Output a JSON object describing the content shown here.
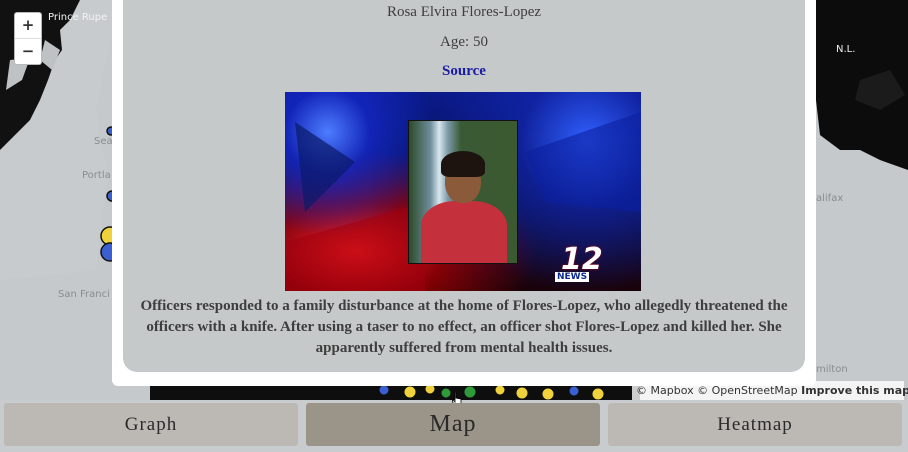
{
  "map": {
    "labels": [
      "Prince Rupe",
      "Sea",
      "Portla",
      "San Franci",
      "N.L.",
      "alifax",
      "milton"
    ],
    "zoom_in_label": "+",
    "zoom_out_label": "−",
    "attribution": {
      "mapbox": "© Mapbox",
      "osm": "© OpenStreetMap",
      "improve": "Improve this map"
    },
    "marker_colors": [
      "#3a5fd0",
      "#f0d23c",
      "#2e9a3a"
    ]
  },
  "popup": {
    "name": "Rosa Elvira Flores-Lopez",
    "age": "Age: 50",
    "source_link": "Source",
    "news_logo_number": "12",
    "news_logo_word": "NEWS",
    "description": "Officers responded to a family disturbance at the home of Flores-Lopez, who allegedly threatened the officers with a knife. After using a taser to no effect, an officer shot Flores-Lopez and killed her. She apparently suffered from mental health issues."
  },
  "tabs": [
    {
      "label": "Graph",
      "active": false
    },
    {
      "label": "Map",
      "active": true
    },
    {
      "label": "Heatmap",
      "active": false
    }
  ]
}
